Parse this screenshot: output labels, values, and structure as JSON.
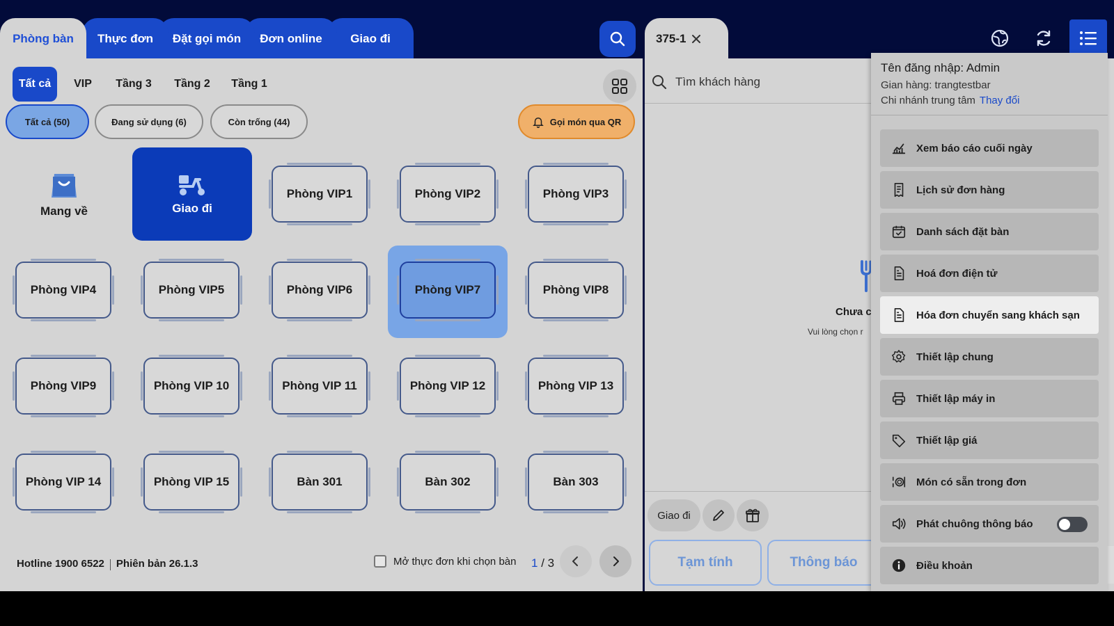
{
  "nav": {
    "tabs": [
      {
        "label": "Phòng bàn",
        "active": true
      },
      {
        "label": "Thực đơn",
        "active": false
      },
      {
        "label": "Đặt gọi món",
        "active": false
      },
      {
        "label": "Đơn online",
        "active": false
      },
      {
        "label": "Giao đi",
        "active": false
      }
    ]
  },
  "filters": {
    "areas": [
      "Tất cả",
      "VIP",
      "Tầng 3",
      "Tầng 2",
      "Tầng 1"
    ],
    "active_area": "Tất cả",
    "status": [
      {
        "label": "Tất cả (50)",
        "active": true
      },
      {
        "label": "Đang sử dụng (6)",
        "active": false
      },
      {
        "label": "Còn trống (44)",
        "active": false
      }
    ],
    "qr_button": "Gọi món qua QR"
  },
  "special_tiles": {
    "takeaway": "Mang về",
    "delivery": "Giao đi"
  },
  "tables": [
    "Phòng VIP1",
    "Phòng VIP2",
    "Phòng VIP3",
    "Phòng VIP4",
    "Phòng VIP5",
    "Phòng VIP6",
    "Phòng VIP7",
    "Phòng VIP8",
    "Phòng VIP9",
    "Phòng VIP 10",
    "Phòng VIP 11",
    "Phòng VIP 12",
    "Phòng VIP 13",
    "Phòng VIP 14",
    "Phòng VIP 15",
    "Bàn 301",
    "Bàn 302",
    "Bàn 303"
  ],
  "selected_table": "Phòng VIP7",
  "footer": {
    "hotline": "Hotline 1900 6522",
    "version": "Phiên bản 26.1.3",
    "open_menu_label": "Mở thực đơn khi chọn bàn",
    "page_current": "1",
    "page_sep": " / ",
    "page_total": "3"
  },
  "order": {
    "tab_label": "375-1",
    "customer_search_placeholder": "Tìm khách hàng",
    "empty_title": "Chưa c",
    "empty_sub": "Vui lòng chọn r",
    "action_delivery": "Giao đi",
    "btn_subtotal": "Tạm tính",
    "btn_notify": "Thông báo"
  },
  "menu": {
    "login": "Tên đăng nhập: Admin",
    "store": "Gian hàng: trangtestbar",
    "branch": "Chi nhánh trung tâm",
    "change": "Thay đổi",
    "items": [
      {
        "label": "Xem báo cáo cuối ngày",
        "icon": "chart-icon"
      },
      {
        "label": "Lịch sử đơn hàng",
        "icon": "receipt-icon"
      },
      {
        "label": "Danh sách đặt bàn",
        "icon": "calendar-icon"
      },
      {
        "label": "Hoá đơn điện tử",
        "icon": "document-icon"
      },
      {
        "label": "Hóa đơn chuyển sang khách sạn",
        "icon": "document-icon"
      },
      {
        "label": "Thiết lập chung",
        "icon": "gear-icon"
      },
      {
        "label": "Thiết lập máy in",
        "icon": "printer-icon"
      },
      {
        "label": "Thiết lập giá",
        "icon": "tag-icon"
      },
      {
        "label": "Món có sẵn trong đơn",
        "icon": "dish-icon"
      },
      {
        "label": "Phát chuông thông báo",
        "icon": "speaker-icon",
        "toggle": false
      },
      {
        "label": "Điều khoản",
        "icon": "info-icon"
      }
    ],
    "hover_item": "Hóa đơn chuyển sang khách sạn"
  },
  "colors": {
    "brand_blue": "#1949c9",
    "dark_navy": "#020b3a",
    "qr_orange": "#f0b06a",
    "selected_blue": "#78a5e6"
  }
}
